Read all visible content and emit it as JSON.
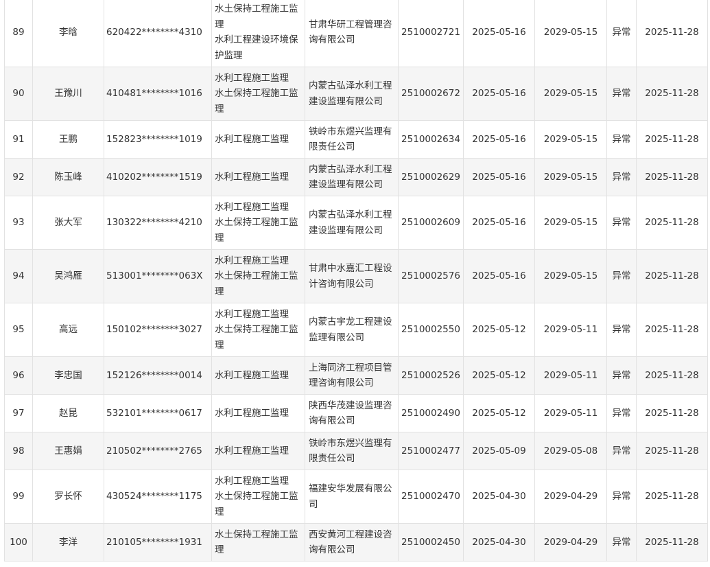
{
  "rows": [
    {
      "no": "89",
      "name": "李晗",
      "id": "620422********4310",
      "specialty": [
        "水土保持工程施工监",
        "理",
        "水利工程建设环境保",
        "护监理"
      ],
      "company": [
        "甘肃华研工程管理咨",
        "询有限公司"
      ],
      "cert": "2510002721",
      "issue": "2025-05-16",
      "expire": "2029-05-15",
      "status": "异常",
      "date": "2025-11-28"
    },
    {
      "no": "90",
      "name": "王豫川",
      "id": "410481********1016",
      "specialty": [
        "水利工程施工监理",
        "水土保持工程施工监",
        "理"
      ],
      "company": [
        "内蒙古弘泽水利工程",
        "建设监理有限公司"
      ],
      "cert": "2510002672",
      "issue": "2025-05-16",
      "expire": "2029-05-15",
      "status": "异常",
      "date": "2025-11-28"
    },
    {
      "no": "91",
      "name": "王鹏",
      "id": "152823********1019",
      "specialty": [
        "水利工程施工监理"
      ],
      "company": [
        "铁岭市东煜兴监理有",
        "限责任公司"
      ],
      "cert": "2510002634",
      "issue": "2025-05-16",
      "expire": "2029-05-15",
      "status": "异常",
      "date": "2025-11-28"
    },
    {
      "no": "92",
      "name": "陈玉峰",
      "id": "410202********1519",
      "specialty": [
        "水利工程施工监理"
      ],
      "company": [
        "内蒙古弘泽水利工程",
        "建设监理有限公司"
      ],
      "cert": "2510002629",
      "issue": "2025-05-16",
      "expire": "2029-05-15",
      "status": "异常",
      "date": "2025-11-28"
    },
    {
      "no": "93",
      "name": "张大军",
      "id": "130322********4210",
      "specialty": [
        "水利工程施工监理",
        "水土保持工程施工监",
        "理"
      ],
      "company": [
        "内蒙古弘泽水利工程",
        "建设监理有限公司"
      ],
      "cert": "2510002609",
      "issue": "2025-05-16",
      "expire": "2029-05-15",
      "status": "异常",
      "date": "2025-11-28"
    },
    {
      "no": "94",
      "name": "吴鸿雁",
      "id": "513001********063X",
      "specialty": [
        "水利工程施工监理",
        "水土保持工程施工监",
        "理"
      ],
      "company": [
        "甘肃中水嘉汇工程设",
        "计咨询有限公司"
      ],
      "cert": "2510002576",
      "issue": "2025-05-16",
      "expire": "2029-05-15",
      "status": "异常",
      "date": "2025-11-28"
    },
    {
      "no": "95",
      "name": "高远",
      "id": "150102********3027",
      "specialty": [
        "水利工程施工监理",
        "水土保持工程施工监",
        "理"
      ],
      "company": [
        "内蒙古宇龙工程建设",
        "监理有限公司"
      ],
      "cert": "2510002550",
      "issue": "2025-05-12",
      "expire": "2029-05-11",
      "status": "异常",
      "date": "2025-11-28"
    },
    {
      "no": "96",
      "name": "李忠国",
      "id": "152126********0014",
      "specialty": [
        "水利工程施工监理"
      ],
      "company": [
        "上海同济工程项目管",
        "理咨询有限公司"
      ],
      "cert": "2510002526",
      "issue": "2025-05-12",
      "expire": "2029-05-11",
      "status": "异常",
      "date": "2025-11-28"
    },
    {
      "no": "97",
      "name": "赵昆",
      "id": "532101********0617",
      "specialty": [
        "水利工程施工监理"
      ],
      "company": [
        "陕西华茂建设监理咨",
        "询有限公司"
      ],
      "cert": "2510002490",
      "issue": "2025-05-12",
      "expire": "2029-05-11",
      "status": "异常",
      "date": "2025-11-28"
    },
    {
      "no": "98",
      "name": "王惠娟",
      "id": "210502********2765",
      "specialty": [
        "水利工程施工监理"
      ],
      "company": [
        "铁岭市东煜兴监理有",
        "限责任公司"
      ],
      "cert": "2510002477",
      "issue": "2025-05-09",
      "expire": "2029-05-08",
      "status": "异常",
      "date": "2025-11-28"
    },
    {
      "no": "99",
      "name": "罗长怀",
      "id": "430524********1175",
      "specialty": [
        "水利工程施工监理",
        "水土保持工程施工监",
        "理"
      ],
      "company": [
        "福建安华发展有限公",
        "司"
      ],
      "cert": "2510002470",
      "issue": "2025-04-30",
      "expire": "2029-04-29",
      "status": "异常",
      "date": "2025-11-28"
    },
    {
      "no": "100",
      "name": "李洋",
      "id": "210105********1931",
      "specialty": [
        "水土保持工程施工监",
        "理"
      ],
      "company": [
        "西安黄河工程建设咨",
        "询有限公司"
      ],
      "cert": "2510002450",
      "issue": "2025-04-30",
      "expire": "2029-04-29",
      "status": "异常",
      "date": "2025-11-28"
    }
  ]
}
